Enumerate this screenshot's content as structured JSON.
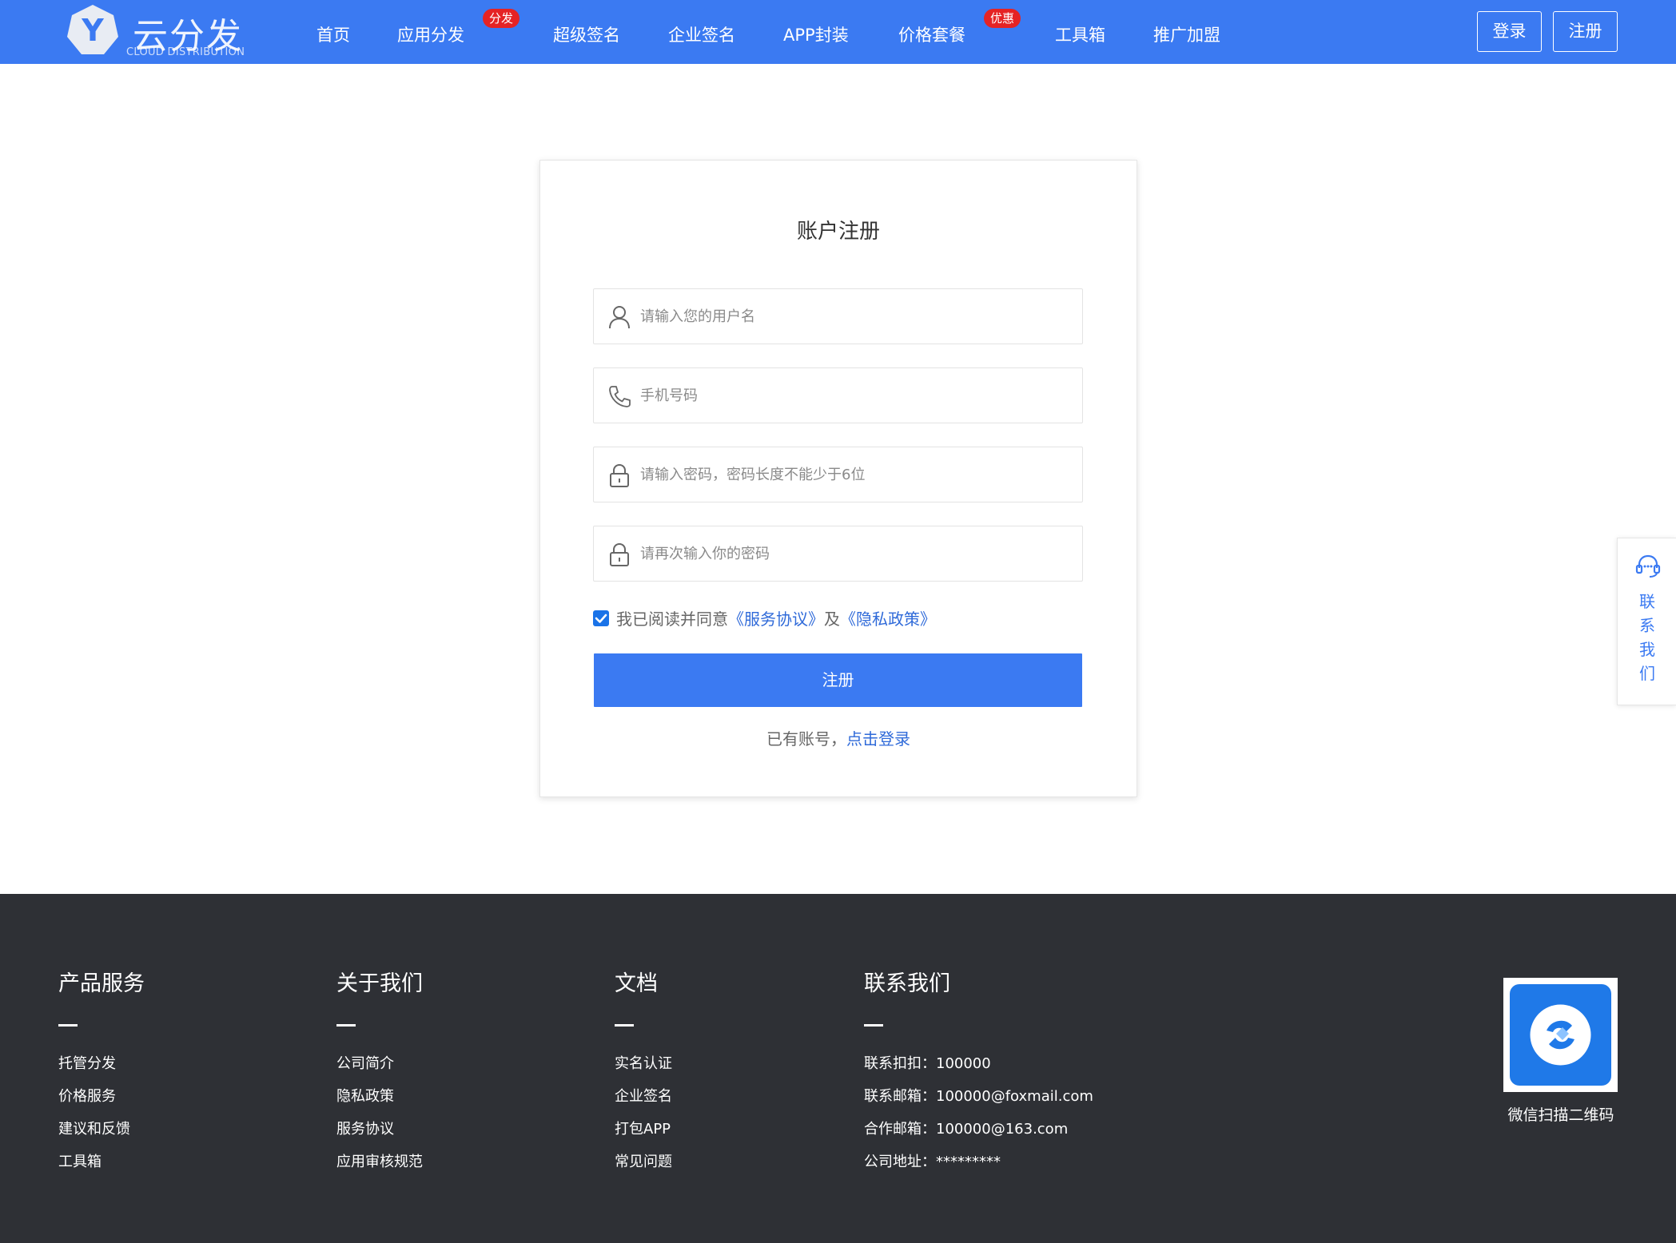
{
  "brand": {
    "logo_letter": "Y",
    "name": "云分发",
    "subtitle": "CLOUD DISTRIBUTION"
  },
  "nav": {
    "items": [
      {
        "label": "首页"
      },
      {
        "label": "应用分发",
        "badge": "分发"
      },
      {
        "label": "超级签名"
      },
      {
        "label": "企业签名"
      },
      {
        "label": "APP封装"
      },
      {
        "label": "价格套餐",
        "badge": "优惠"
      },
      {
        "label": "工具箱"
      },
      {
        "label": "推广加盟"
      }
    ],
    "login_label": "登录",
    "register_label": "注册"
  },
  "form": {
    "title": "账户注册",
    "username_placeholder": "请输入您的用户名",
    "phone_placeholder": "手机号码",
    "password_placeholder": "请输入密码，密码长度不能少于6位",
    "confirm_placeholder": "请再次输入你的密码",
    "agree_checked": true,
    "agree_prefix": "我已阅读并同意",
    "service_link": "《服务协议》",
    "agree_and": "及",
    "privacy_link": "《隐私政策》",
    "submit_label": "注册",
    "has_account": "已有账号，",
    "login_link": "点击登录"
  },
  "float_contact": {
    "label": "联系我们",
    "icon": "headset-icon"
  },
  "footer": {
    "columns": [
      {
        "title": "产品服务",
        "items": [
          "托管分发",
          "价格服务",
          "建议和反馈",
          "工具箱"
        ]
      },
      {
        "title": "关于我们",
        "items": [
          "公司简介",
          "隐私政策",
          "服务协议",
          "应用审核规范"
        ]
      },
      {
        "title": "文档",
        "items": [
          "实名认证",
          "企业签名",
          "打包APP",
          "常见问题"
        ]
      },
      {
        "title": "联系我们",
        "items": [
          "联系扣扣：100000",
          "联系邮箱：100000@foxmail.com",
          "合作邮箱：100000@163.com",
          "公司地址：*********"
        ]
      }
    ],
    "qr_caption": "微信扫描二维码"
  },
  "colors": {
    "primary": "#3b7af2",
    "badge": "#e52324",
    "footer_bg": "#2e3035",
    "link": "#2f6ad9"
  }
}
